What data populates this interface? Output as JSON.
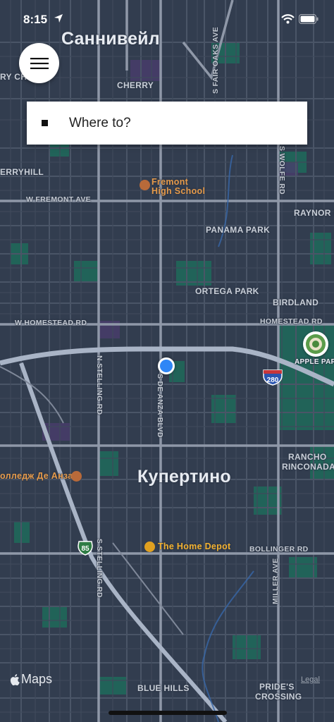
{
  "status_bar": {
    "time": "8:15"
  },
  "search": {
    "placeholder": "Where to?"
  },
  "map": {
    "cities": {
      "top": "Саннивейл",
      "center": "Купертино"
    },
    "neighborhoods": {
      "panama_park": "PANAMA PARK",
      "ortega_park": "ORTEGA PARK",
      "birdland": "BIRDLAND",
      "raynor_park": "RAYNOR PARK",
      "rancho_rinconada_1": "RANCHO",
      "rancho_rinconada_2": "RINCONADA",
      "blue_hills": "BLUE HILLS",
      "prides_crossing_1": "PRIDE'S",
      "prides_crossing_2": "CROSSING",
      "cherry_chase": "RY CH",
      "cherryhill": "ERRYHILL",
      "cherry": "CHERRY"
    },
    "streets": {
      "w_fremont": "W FREMONT AVE",
      "w_homestead": "W HOMESTEAD RD",
      "homestead": "HOMESTEAD RD",
      "bollinger": "BOLLINGER RD",
      "s_fair_oaks": "S FAIR OAKS AVE",
      "s_wolfe": "S WOLFE RD",
      "n_stelling": "N STELLING RD",
      "s_stelling": "S STELLING RD",
      "deanza": "S DE ANZA BLVD",
      "miller": "MILLER AVE"
    },
    "pois": {
      "fremont_hs_1": "Fremont",
      "fremont_hs_2": "High School",
      "deanza_college": "олледж Де Анза",
      "home_depot": "The Home Depot",
      "apple_park": "APPLE PARK"
    },
    "highways": {
      "i280": "280",
      "ca85": "85"
    }
  },
  "footer": {
    "maps_brand": "Maps",
    "legal": "Legal"
  }
}
